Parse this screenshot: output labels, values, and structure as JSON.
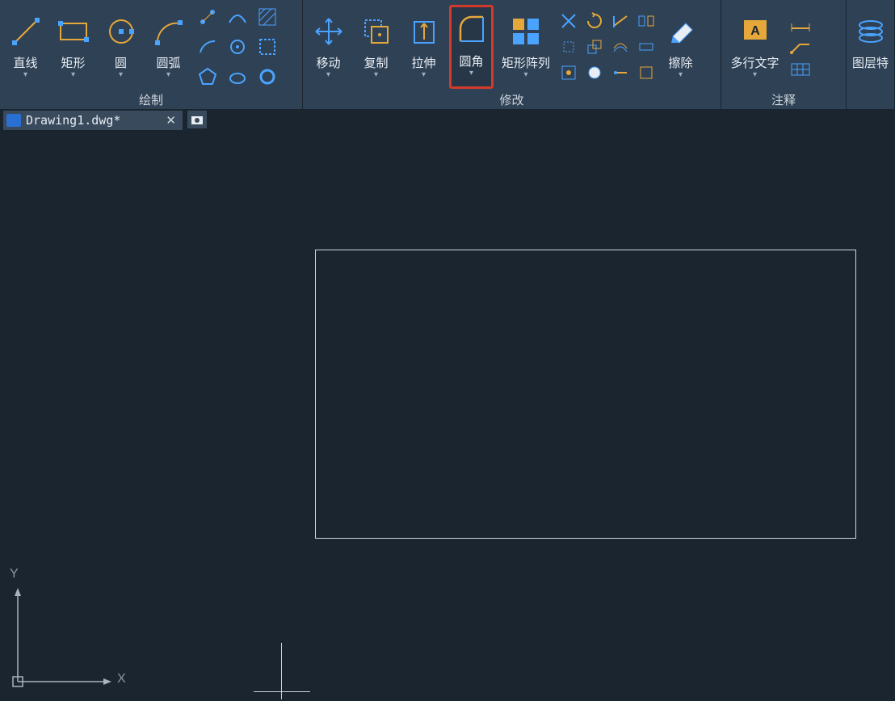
{
  "file_tab": {
    "name": "Drawing1.dwg*"
  },
  "panels": {
    "draw": {
      "title": "绘制"
    },
    "modify": {
      "title": "修改"
    },
    "annotate": {
      "title": "注释"
    },
    "layer": {
      "title": ""
    }
  },
  "axes": {
    "x": "X",
    "y": "Y"
  },
  "draw_tools": {
    "line": "直线",
    "rect": "矩形",
    "circle": "圆",
    "arc": "圆弧"
  },
  "modify_tools": {
    "move": "移动",
    "copy": "复制",
    "stretch": "拉伸",
    "fillet": "圆角",
    "array": "矩形阵列",
    "erase": "擦除"
  },
  "annotate_tools": {
    "mtext": "多行文字"
  },
  "layer_tools": {
    "props": "图层特"
  },
  "colors": {
    "accent": "#e6a83a",
    "blue": "#4aa3ff",
    "highlight": "#d43a2a"
  }
}
